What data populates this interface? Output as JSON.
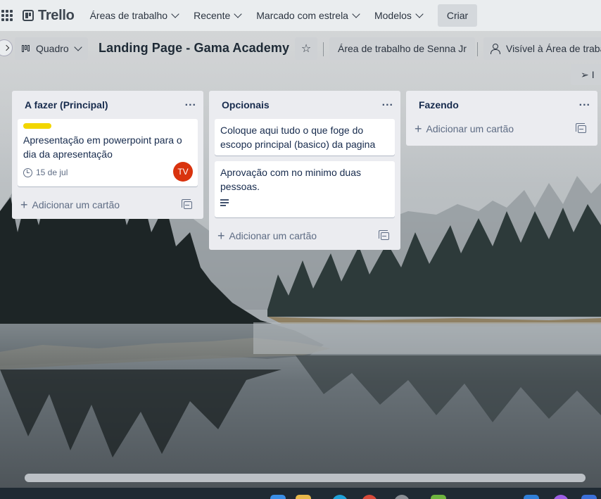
{
  "colors": {
    "header_bg": "#eceff1",
    "list_bg": "#ebecf0",
    "label_yellow": "#f2d600",
    "avatar_red": "#d9330e",
    "taskbar": "#1f2a33"
  },
  "topbar": {
    "logo": "Trello",
    "nav": [
      "Áreas de trabalho",
      "Recente",
      "Marcado com estrela",
      "Modelos"
    ],
    "create_label": "Criar"
  },
  "board": {
    "view_label": "Quadro",
    "title": "Landing Page - Gama Academy",
    "workspace_label": "Área de trabalho de Senna Jr",
    "visibility_label": "Visível à Área de traba",
    "share_label": "I"
  },
  "lists": [
    {
      "title": "A fazer (Principal)",
      "menu": "...",
      "cards": [
        {
          "label_color": "yellow",
          "text": "Apresentação em powerpoint para o dia da apresentação",
          "due": "15 de jul",
          "member_initials": "TV"
        }
      ],
      "add_label": "Adicionar um cartão"
    },
    {
      "title": "Opcionais",
      "menu": "...",
      "cards": [
        {
          "text": "Coloque aqui tudo o que foge do escopo principal (basico) da pagina"
        },
        {
          "text": "Aprovação com no minimo duas pessoas.",
          "has_description": true
        }
      ],
      "add_label": "Adicionar um cartão"
    },
    {
      "title": "Fazendo",
      "menu": "...",
      "cards": [],
      "add_label": "Adicionar um cartão"
    }
  ]
}
